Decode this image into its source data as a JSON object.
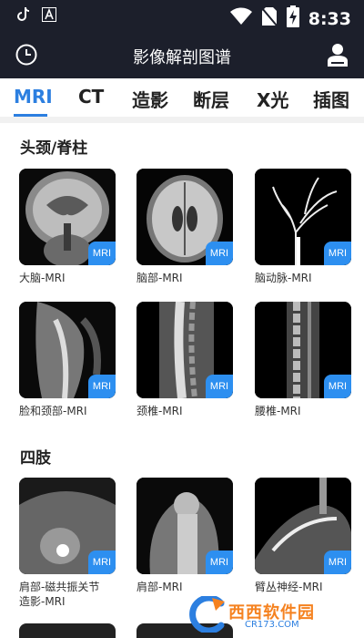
{
  "status_bar": {
    "time": "8:33"
  },
  "header": {
    "title": "影像解剖图谱"
  },
  "tabs": [
    {
      "label": "MRI",
      "active": true
    },
    {
      "label": "CT"
    },
    {
      "label": "造影"
    },
    {
      "label": "断层"
    },
    {
      "label": "X光"
    },
    {
      "label": "插图"
    }
  ],
  "sections": [
    {
      "title": "头颈/脊柱",
      "items": [
        {
          "label": "大脑-MRI",
          "badge": "MRI"
        },
        {
          "label": "脑部-MRI",
          "badge": "MRI"
        },
        {
          "label": "脑动脉-MRI",
          "badge": "MRI"
        },
        {
          "label": "脸和颈部-MRI",
          "badge": "MRI"
        },
        {
          "label": "颈椎-MRI",
          "badge": "MRI"
        },
        {
          "label": "腰椎-MRI",
          "badge": "MRI"
        }
      ]
    },
    {
      "title": "四肢",
      "items": [
        {
          "label": "肩部-磁共振关节\n造影-MRI",
          "badge": "MRI"
        },
        {
          "label": "肩部-MRI",
          "badge": "MRI"
        },
        {
          "label": "臂丛神经-MRI",
          "badge": "MRI"
        }
      ]
    }
  ],
  "watermark": {
    "text": "西西软件园",
    "sub": "CR173.COM"
  },
  "colors": {
    "header_bg": "#1c1f2b",
    "accent": "#2c7fe0",
    "badge": "#2d8ff0",
    "watermark": "#f58220"
  }
}
